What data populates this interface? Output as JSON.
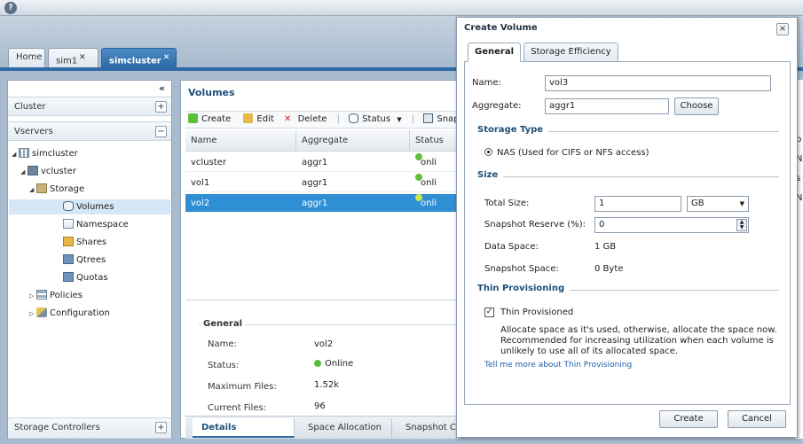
{
  "top_tabs": [
    {
      "label": "Home",
      "closable": false
    },
    {
      "label": "sim1",
      "closable": true
    },
    {
      "label": "simcluster",
      "closable": true,
      "active": true
    }
  ],
  "sidebar": {
    "collapse_symbol": "«",
    "cluster_label": "Cluster",
    "vservers_label": "Vservers",
    "storage_controllers_label": "Storage Controllers",
    "plus": "+",
    "minus": "−",
    "tree": {
      "simcluster": "simcluster",
      "vcluster": "vcluster",
      "storage": "Storage",
      "volumes": "Volumes",
      "namespace": "Namespace",
      "shares": "Shares",
      "qtrees": "Qtrees",
      "quotas": "Quotas",
      "policies": "Policies",
      "configuration": "Configuration"
    }
  },
  "main": {
    "title": "Volumes",
    "toolbar": {
      "create": "Create",
      "edit": "Edit",
      "delete": "Delete",
      "status": "Status",
      "snapshot": "Snapshot Co"
    },
    "columns": [
      "Name",
      "Aggregate",
      "Status"
    ],
    "rows": [
      {
        "name": "vcluster",
        "aggregate": "aggr1",
        "status": "onli"
      },
      {
        "name": "vol1",
        "aggregate": "aggr1",
        "status": "onli"
      },
      {
        "name": "vol2",
        "aggregate": "aggr1",
        "status": "onli",
        "selected": true
      }
    ],
    "details": {
      "legend": "General",
      "name_label": "Name:",
      "name_value": "vol2",
      "status_label": "Status:",
      "status_value": "Online",
      "max_files_label": "Maximum Files:",
      "max_files_value": "1.52k",
      "current_files_label": "Current Files:",
      "current_files_value": "96"
    },
    "bottom_tabs": [
      "Details",
      "Space Allocation",
      "Snapshot Co"
    ]
  },
  "right_behind_letters": [
    "b",
    "N",
    "s",
    "N"
  ],
  "dialog": {
    "title": "Create Volume",
    "close": "×",
    "tabs": [
      "General",
      "Storage Efficiency"
    ],
    "name_label": "Name:",
    "name_value": "vol3",
    "aggregate_label": "Aggregate:",
    "aggregate_value": "aggr1",
    "choose": "Choose",
    "storage_type_legend": "Storage Type",
    "storage_type_option": "NAS (Used for CIFS or NFS access)",
    "size_legend": "Size",
    "total_size_label": "Total Size:",
    "total_size_value": "1",
    "total_size_unit": "GB",
    "snapshot_reserve_label": "Snapshot Reserve (%):",
    "snapshot_reserve_value": "0",
    "data_space_label": "Data Space:",
    "data_space_value": "1 GB",
    "snapshot_space_label": "Snapshot Space:",
    "snapshot_space_value": "0 Byte",
    "thin_legend": "Thin Provisioning",
    "thin_checkbox_label": "Thin Provisioned",
    "thin_checked": true,
    "thin_description": "Allocate space as it's used, otherwise, allocate the space now. Recommended for increasing utilization when each volume is unlikely to use all of its allocated space.",
    "thin_link": "Tell me more about Thin Provisioning",
    "create": "Create",
    "cancel": "Cancel"
  },
  "colors": {
    "accent": "#2f6aa6",
    "selection": "#2e8fd5",
    "online": "#5bbf3b",
    "link": "#1f5fa8"
  }
}
